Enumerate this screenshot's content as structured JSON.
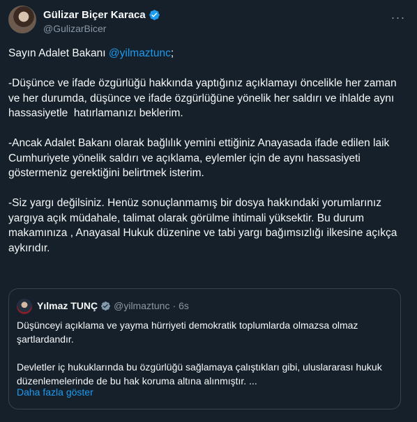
{
  "author": {
    "name": "Gülizar Biçer Karaca",
    "handle": "@GulizarBicer"
  },
  "more_icon": "more-horizontal-icon",
  "tweet": {
    "greeting_prefix": "Sayın Adalet Bakanı ",
    "greeting_mention": "@yilmaztunc",
    "greeting_suffix": ";",
    "paragraph_1": "-Düşünce ve ifade özgürlüğü hakkında yaptığınız açıklamayı öncelikle her zaman ve her durumda, düşünce ve ifade özgürlüğüne yönelik her saldırı ve ihlalde aynı hassasiyetle  hatırlamanızı beklerim.",
    "paragraph_2": "-Ancak Adalet Bakanı olarak bağlılık yemini ettiğiniz Anayasada ifade edilen laik Cumhuriyete yönelik saldırı ve açıklama, eylemler için de aynı hassasiyeti göstermeniz gerektiğini belirtmek isterim.",
    "paragraph_3": "-Siz yargı değilsiniz. Henüz sonuçlanmamış bir dosya hakkındaki yorumlarınız yargıya açık müdahale, talimat olarak görülme ihtimali yüksektir. Bu durum makamınıza , Anayasal Hukuk düzenine ve tabi yargı bağımsızlığı ilkesine açıkça aykırıdır."
  },
  "quoted": {
    "name": "Yılmaz TUNÇ",
    "handle": "@yilmaztunc",
    "separator": "·",
    "time": "6s",
    "paragraph_1": "Düşünceyi açıklama ve yayma hürriyeti demokratik toplumlarda olmazsa olmaz şartlardandır.",
    "paragraph_2": "Devletler iç hukuklarında bu özgürlüğü sağlamaya çalıştıkları gibi, uluslararası hukuk düzenlemelerinde de bu hak koruma altına alınmıştır. ...",
    "show_more": "Daha fazla göster"
  },
  "colors": {
    "background": "#15202b",
    "accent": "#1d9bf0",
    "muted": "#8b98a5",
    "border": "#38444d"
  }
}
